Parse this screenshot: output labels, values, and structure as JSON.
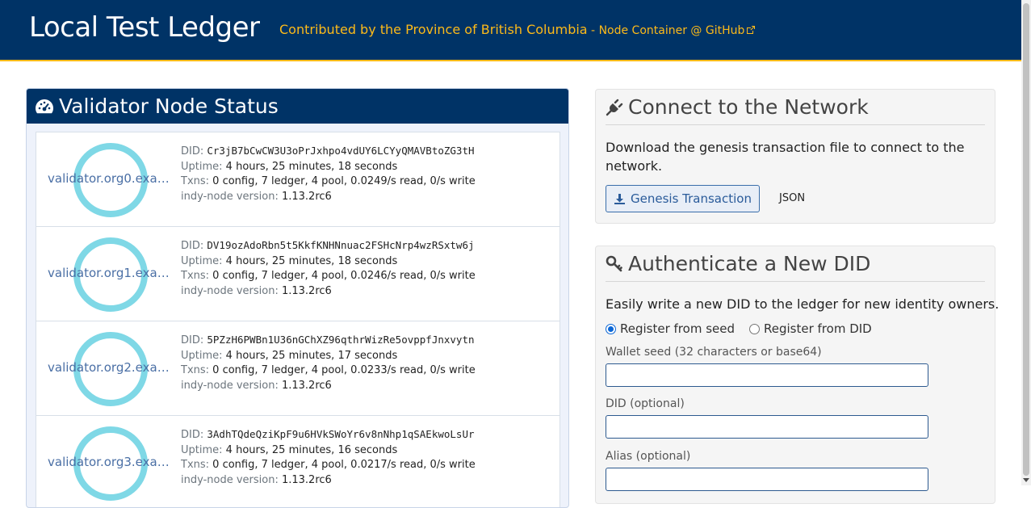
{
  "header": {
    "title": "Local Test Ledger",
    "contributor": "Contributed by the Province of British Columbia",
    "separator": " - ",
    "repo_link": "Node Container @ GitHub"
  },
  "validator_panel": {
    "title": "Validator Node Status",
    "labels": {
      "did": "DID:",
      "uptime": "Uptime:",
      "txns": "Txns:",
      "version": "indy-node version:"
    },
    "nodes": [
      {
        "name": "validator.org0.exam...",
        "did": "Cr3jB7bCwCW3U3oPrJxhpo4vdUY6LCYyQMAVBtoZG3tH",
        "uptime": "4 hours, 25 minutes, 18 seconds",
        "txns": "0 config, 7 ledger, 4 pool, 0.0249/s read, 0/s write",
        "version": "1.13.2rc6"
      },
      {
        "name": "validator.org1.exam...",
        "did": "DV19ozAdoRbn5t5KkfKNHNnuac2FSHcNrp4wzRSxtw6j",
        "uptime": "4 hours, 25 minutes, 18 seconds",
        "txns": "0 config, 7 ledger, 4 pool, 0.0246/s read, 0/s write",
        "version": "1.13.2rc6"
      },
      {
        "name": "validator.org2.exam...",
        "did": "5PZzH6PWBn1U36nGChXZ96qthrWizRe5ovppfJnxvytn",
        "uptime": "4 hours, 25 minutes, 17 seconds",
        "txns": "0 config, 7 ledger, 4 pool, 0.0233/s read, 0/s write",
        "version": "1.13.2rc6"
      },
      {
        "name": "validator.org3.exam...",
        "did": "3AdhTQdeQziKpF9u6HVkSWoYr6v8nNhp1qSAEkwoLsUr",
        "uptime": "4 hours, 25 minutes, 16 seconds",
        "txns": "0 config, 7 ledger, 4 pool, 0.0217/s read, 0/s write",
        "version": "1.13.2rc6"
      }
    ]
  },
  "connect_panel": {
    "title": "Connect to the Network",
    "description": "Download the genesis transaction file to connect to the network.",
    "genesis_button": "Genesis Transaction",
    "json_link": "JSON"
  },
  "auth_panel": {
    "title": "Authenticate a New DID",
    "description": "Easily write a new DID to the ledger for new identity owners.",
    "radio_seed": "Register from seed",
    "radio_did": "Register from DID",
    "seed_label": "Wallet seed (32 characters or base64)",
    "seed_value": "",
    "did_label": "DID (optional)",
    "did_value": "",
    "alias_label": "Alias (optional)",
    "alias_value": ""
  },
  "colors": {
    "header_bg": "#003366",
    "accent_gold": "#fcba19",
    "ring": "#7fd8e6"
  },
  "icons": {
    "header_link": "external-link-icon",
    "validator_panel": "dashboard-icon",
    "connect_panel": "plug-icon",
    "auth_panel": "key-icon",
    "genesis_button": "download-icon"
  }
}
